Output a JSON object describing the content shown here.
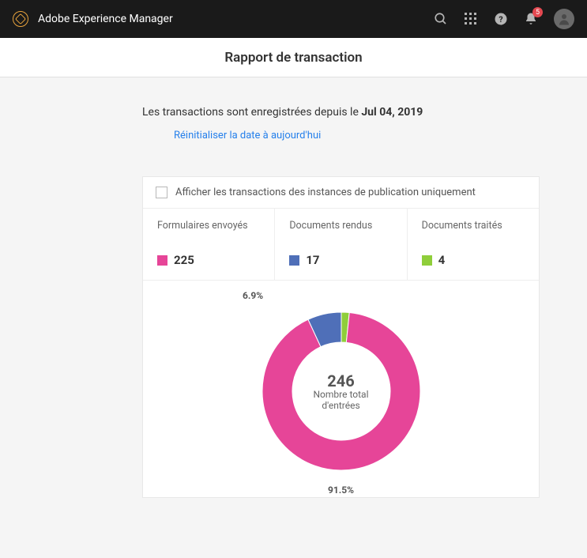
{
  "brand": "Adobe Experience Manager",
  "notifications_count": "5",
  "page_title": "Rapport de transaction",
  "intro_prefix": "Les transactions sont enregistrées depuis le ",
  "intro_date": "Jul 04, 2019",
  "reset_link": "Réinitialiser la date à aujourd'hui",
  "filter_label": "Afficher les transactions des instances de publication uniquement",
  "stats": {
    "forms": {
      "title": "Formulaires envoyés",
      "value": "225",
      "color": "#e64598"
    },
    "rendered": {
      "title": "Documents rendus",
      "value": "17",
      "color": "#4f6fb8"
    },
    "processed": {
      "title": "Documents traités",
      "value": "4",
      "color": "#8fce3a"
    }
  },
  "chart_data": {
    "type": "pie",
    "total_value": "246",
    "total_label": "Nombre total d'entrées",
    "series": [
      {
        "name": "Formulaires envoyés",
        "value": 225,
        "pct": "91.5%",
        "color": "#e64598"
      },
      {
        "name": "Documents rendus",
        "value": 17,
        "pct": "6.9%",
        "color": "#4f6fb8"
      },
      {
        "name": "Documents traités",
        "value": 4,
        "pct": "1.6%",
        "color": "#8fce3a"
      }
    ]
  }
}
